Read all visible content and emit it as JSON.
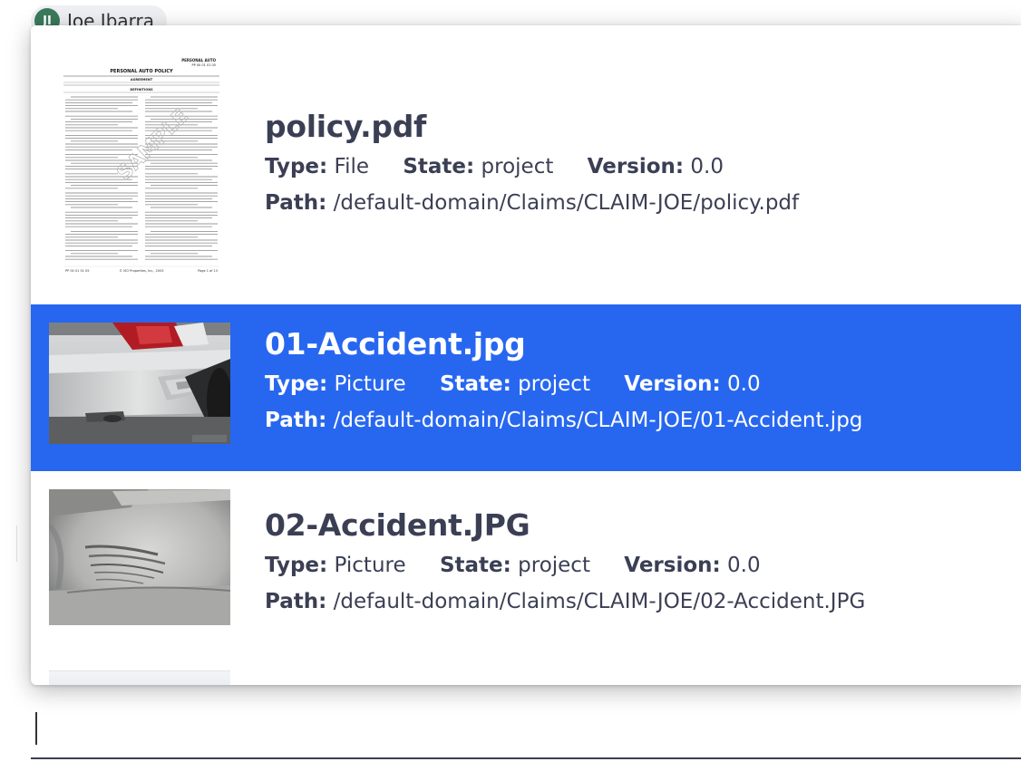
{
  "user": {
    "initials": "JI",
    "name": "Joe Ibarra"
  },
  "results": [
    {
      "title": "policy.pdf",
      "type_label": "Type:",
      "type": "File",
      "state_label": "State:",
      "state": "project",
      "version_label": "Version:",
      "version": "0.0",
      "path_label": "Path:",
      "path": "/default-domain/Claims/CLAIM-JOE/policy.pdf",
      "selected": false,
      "thumbnail": "pdf-page-thumbnail"
    },
    {
      "title": "01-Accident.jpg",
      "type_label": "Type:",
      "type": "Picture",
      "state_label": "State:",
      "state": "project",
      "version_label": "Version:",
      "version": "0.0",
      "path_label": "Path:",
      "path": "/default-domain/Claims/CLAIM-JOE/01-Accident.jpg",
      "selected": true,
      "thumbnail": "car-damage-photo"
    },
    {
      "title": "02-Accident.JPG",
      "type_label": "Type:",
      "type": "Picture",
      "state_label": "State:",
      "state": "project",
      "version_label": "Version:",
      "version": "0.0",
      "path_label": "Path:",
      "path": "/default-domain/Claims/CLAIM-JOE/02-Accident.JPG",
      "selected": false,
      "thumbnail": "car-scratch-photo"
    }
  ],
  "pdf_thumbnail": {
    "header_right_1": "PERSONAL AUTO",
    "header_right_2": "PP 00 01 01 05",
    "heading": "PERSONAL AUTO POLICY",
    "section_1": "AGREEMENT",
    "section_2": "DEFINITIONS",
    "footer_left": "PP 00 01 01 05",
    "footer_mid": "© ISO Properties, Inc., 2003",
    "footer_right": "Page 1 of 13",
    "watermark": "SAMPLE"
  },
  "search": {
    "value": ""
  },
  "colors": {
    "selected_row": "#2767f0",
    "text": "#3b3f54",
    "selected_text": "#ffffff"
  }
}
